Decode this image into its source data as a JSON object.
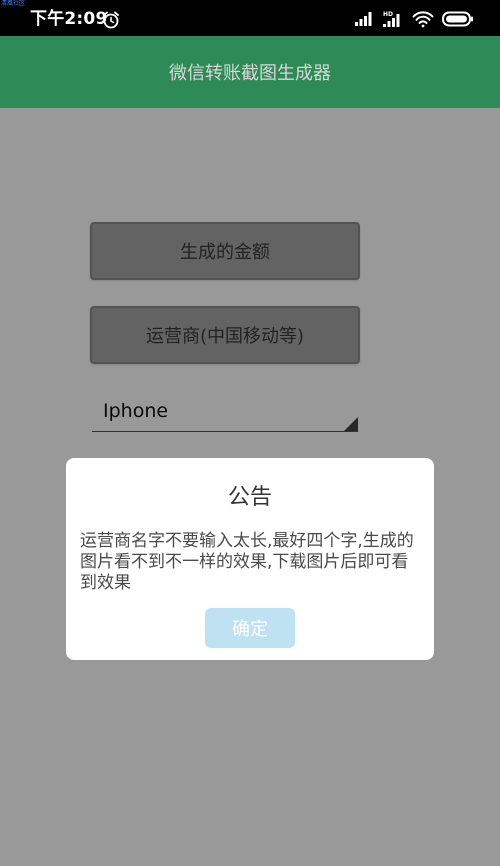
{
  "status_bar": {
    "watermark": "清風社区",
    "time": "下午2:09",
    "alarm_icon": "alarm-clock-icon",
    "signal_icon": "cellular-signal-icon",
    "hd_icon": "hd-signal-icon",
    "wifi_icon": "wifi-icon",
    "battery_icon": "battery-icon"
  },
  "app_bar": {
    "title": "微信转账截图生成器"
  },
  "form": {
    "amount_button_label": "生成的金额",
    "carrier_button_label": "运营商(中国移动等)",
    "device_select_value": "Iphone"
  },
  "dialog": {
    "title": "公告",
    "message": "运营商名字不要输入太长,最好四个字,生成的图片看不到不一样的效果,下载图片后即可看到效果",
    "ok_label": "确定"
  },
  "colors": {
    "app_bar": "#2e8b57",
    "status_bar": "#000000",
    "dialog_button": "#bfe2f2"
  }
}
